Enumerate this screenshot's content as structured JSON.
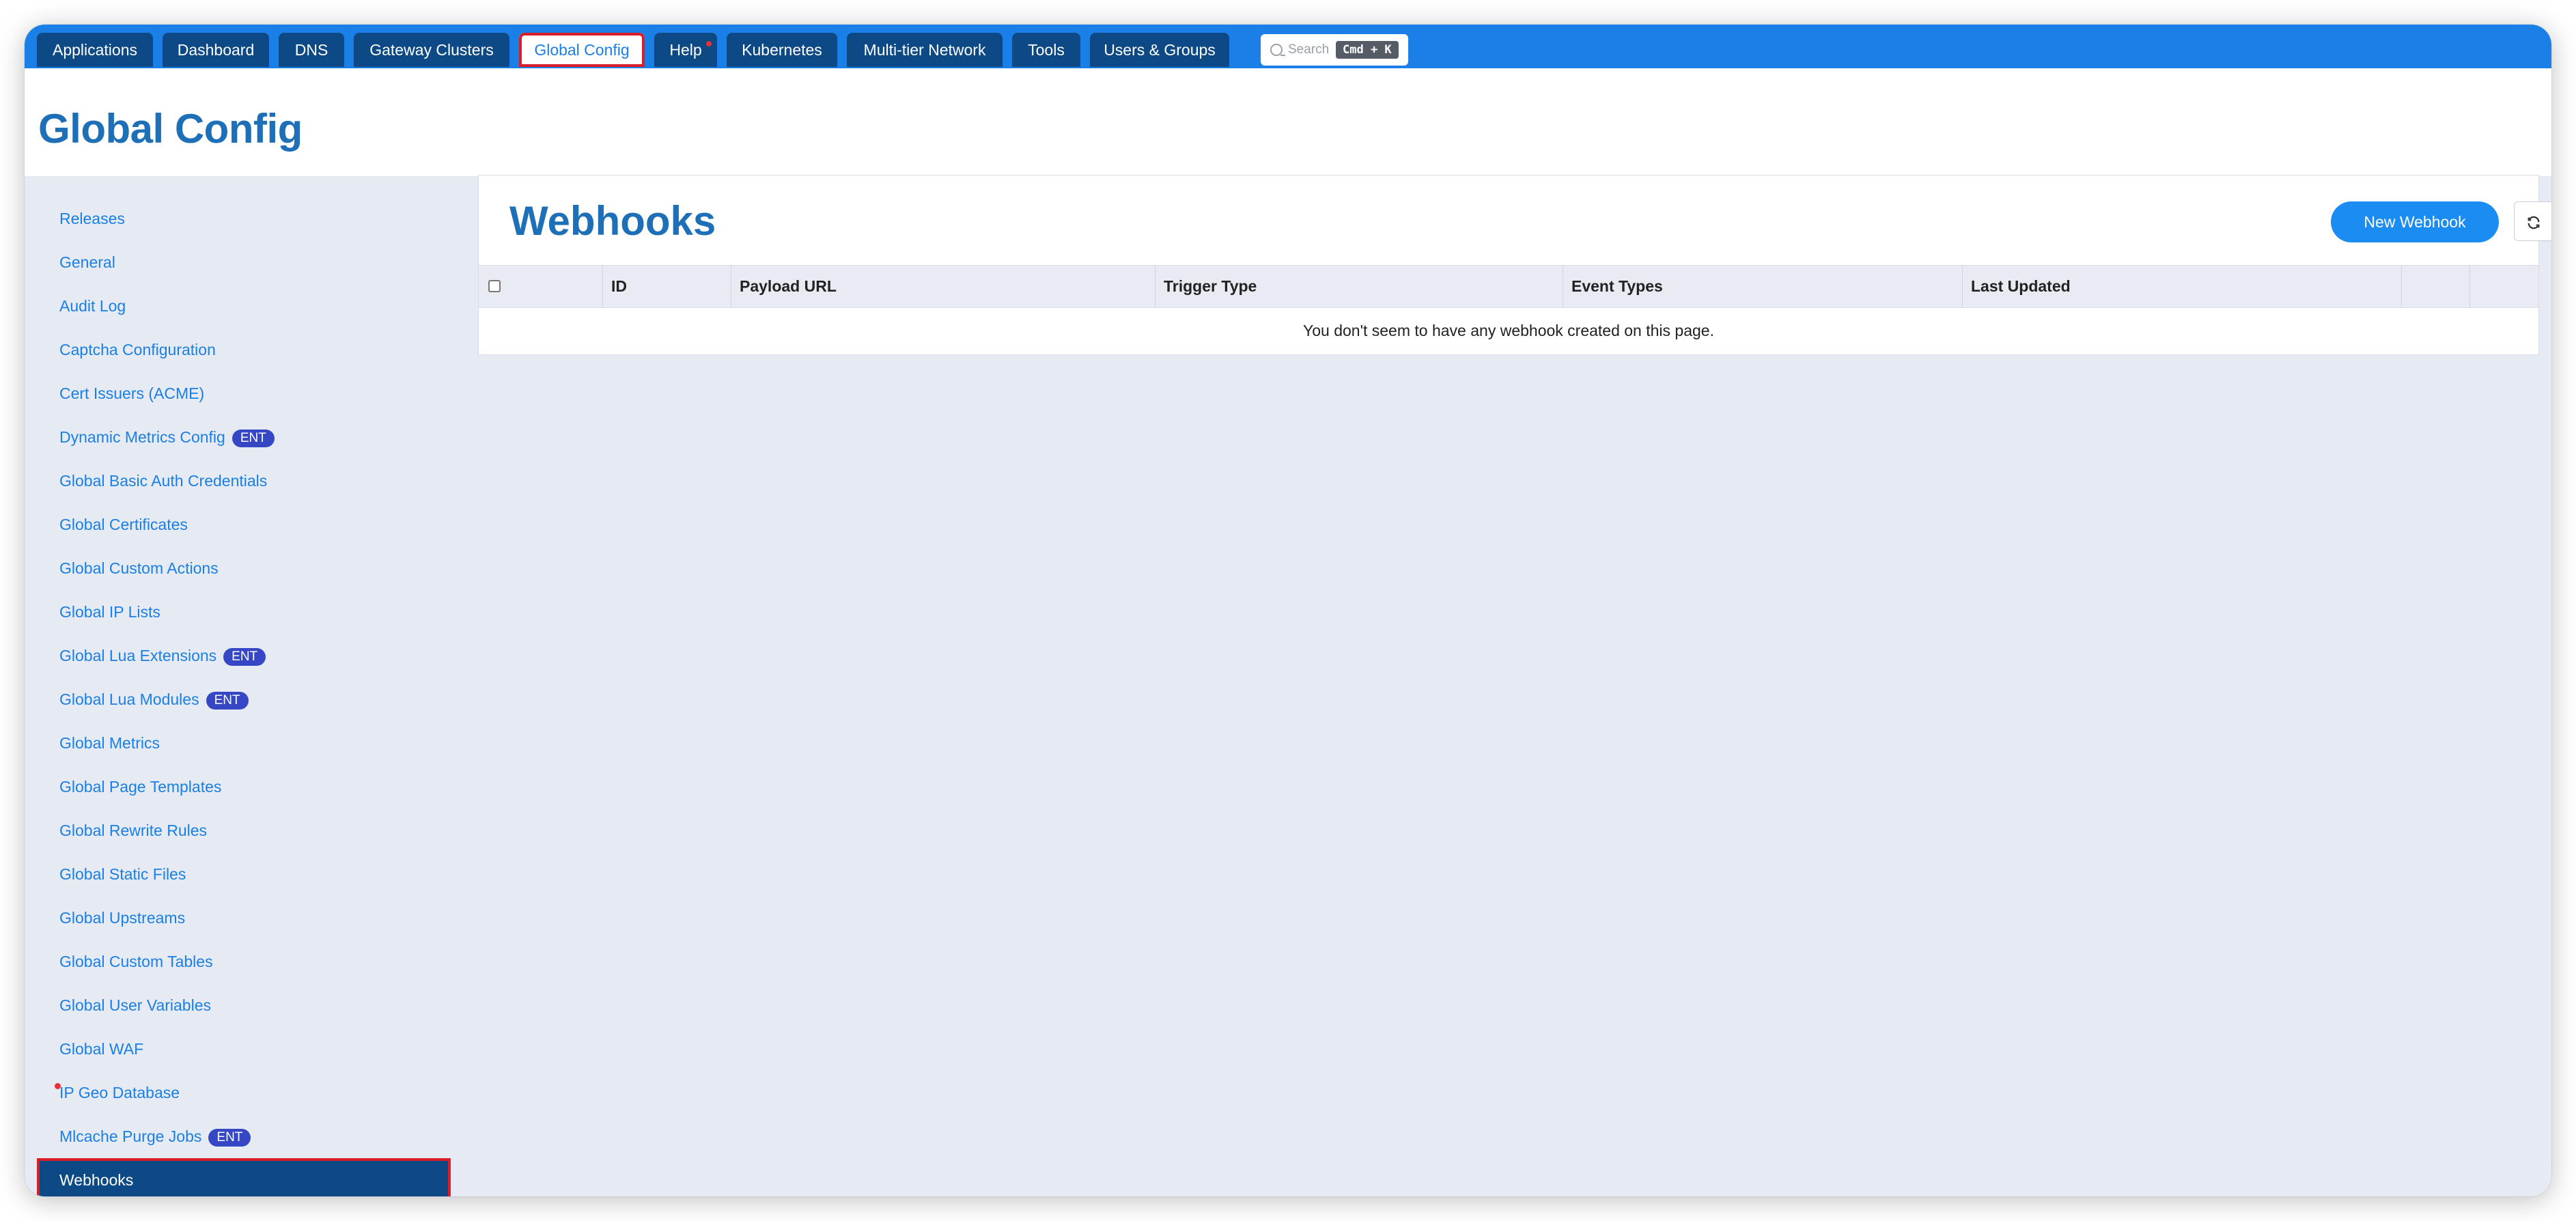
{
  "topnav": {
    "tabs": [
      {
        "label": "Applications"
      },
      {
        "label": "Dashboard"
      },
      {
        "label": "DNS"
      },
      {
        "label": "Gateway Clusters"
      },
      {
        "label": "Global Config",
        "active": true
      },
      {
        "label": "Help",
        "notification_dot": true
      },
      {
        "label": "Kubernetes"
      },
      {
        "label": "Multi-tier Network"
      },
      {
        "label": "Tools"
      },
      {
        "label": "Users & Groups"
      }
    ],
    "search": {
      "placeholder": "Search",
      "shortcut": "Cmd + K"
    }
  },
  "header": {
    "title": "Global Config"
  },
  "sidebar": {
    "items": [
      {
        "label": "Releases"
      },
      {
        "label": "General"
      },
      {
        "label": "Audit Log"
      },
      {
        "label": "Captcha Configuration"
      },
      {
        "label": "Cert Issuers (ACME)"
      },
      {
        "label": "Dynamic Metrics Config",
        "badge": "ENT"
      },
      {
        "label": "Global Basic Auth Credentials"
      },
      {
        "label": "Global Certificates"
      },
      {
        "label": "Global Custom Actions"
      },
      {
        "label": "Global IP Lists"
      },
      {
        "label": "Global Lua Extensions",
        "badge": "ENT"
      },
      {
        "label": "Global Lua Modules",
        "badge": "ENT"
      },
      {
        "label": "Global Metrics"
      },
      {
        "label": "Global Page Templates"
      },
      {
        "label": "Global Rewrite Rules"
      },
      {
        "label": "Global Static Files"
      },
      {
        "label": "Global Upstreams"
      },
      {
        "label": "Global Custom Tables"
      },
      {
        "label": "Global User Variables"
      },
      {
        "label": "Global WAF"
      },
      {
        "label": "IP Geo Database",
        "notification_dot": true
      },
      {
        "label": "Mlcache Purge Jobs",
        "badge": "ENT"
      },
      {
        "label": "Webhooks",
        "selected": true
      }
    ]
  },
  "main": {
    "title": "Webhooks",
    "new_button": "New Webhook",
    "refresh_icon": "refresh-icon",
    "table": {
      "columns": [
        "ID",
        "Payload URL",
        "Trigger Type",
        "Event Types",
        "Last Updated"
      ],
      "empty_message": "You don't seem to have any webhook created on this page."
    }
  },
  "colors": {
    "nav_bg": "#1a7fe6",
    "tab_bg": "#0d4a85",
    "highlight": "#d91e2a",
    "title": "#1d6fb8",
    "link": "#1a7fe6",
    "badge": "#3547c4",
    "button": "#1a8cf2"
  }
}
